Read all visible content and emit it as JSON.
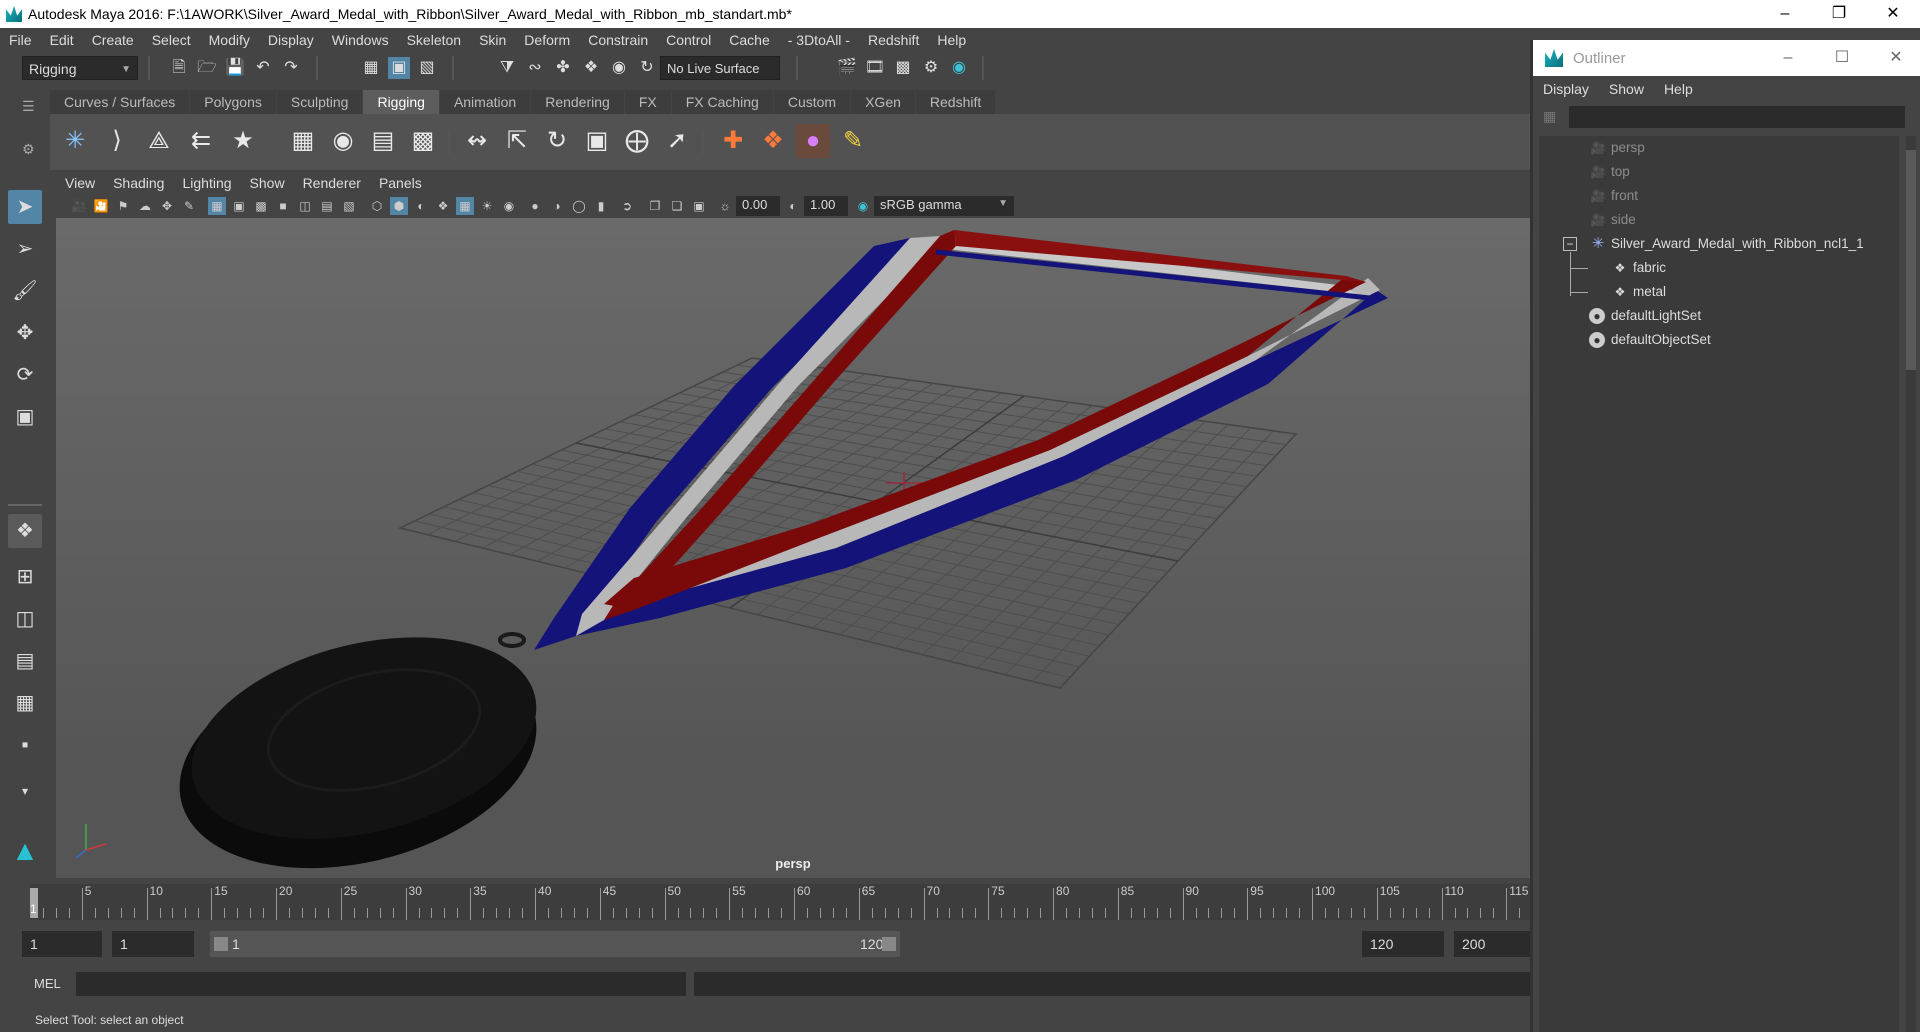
{
  "window": {
    "title": "Autodesk Maya 2016: F:\\1AWORK\\Silver_Award_Medal_with_Ribbon\\Silver_Award_Medal_with_Ribbon_mb_standart.mb*"
  },
  "menus": [
    "File",
    "Edit",
    "Create",
    "Select",
    "Modify",
    "Display",
    "Windows",
    "Skeleton",
    "Skin",
    "Deform",
    "Constrain",
    "Control",
    "Cache",
    "- 3DtoAll -",
    "Redshift",
    "Help"
  ],
  "statusline": {
    "menuset": "Rigging",
    "live_surface": "No Live Surface"
  },
  "shelf_tabs": [
    "Curves / Surfaces",
    "Polygons",
    "Sculpting",
    "Rigging",
    "Animation",
    "Rendering",
    "FX",
    "FX Caching",
    "Custom",
    "XGen",
    "Redshift"
  ],
  "active_shelf_tab": "Rigging",
  "viewport": {
    "menu": [
      "View",
      "Shading",
      "Lighting",
      "Show",
      "Renderer",
      "Panels"
    ],
    "exposure": "0.00",
    "gamma": "1.00",
    "color_space": "sRGB gamma",
    "camera": "persp"
  },
  "timeline": {
    "ticks": [
      "5",
      "10",
      "15",
      "20",
      "25",
      "30",
      "35",
      "40",
      "45",
      "50",
      "55",
      "60",
      "65",
      "70",
      "75",
      "80",
      "85",
      "90",
      "95",
      "100",
      "105",
      "110",
      "115"
    ],
    "current": "1"
  },
  "range": {
    "start": "1",
    "playback_start": "1",
    "slider_start": "1",
    "slider_end": "120",
    "playback_end": "120",
    "end": "200"
  },
  "command_line": {
    "label": "MEL"
  },
  "help_line": "Select Tool: select an object",
  "outliner": {
    "title": "Outliner",
    "menu": [
      "Display",
      "Show",
      "Help"
    ],
    "items": [
      {
        "label": "persp",
        "type": "camera",
        "dim": true
      },
      {
        "label": "top",
        "type": "camera",
        "dim": true
      },
      {
        "label": "front",
        "type": "camera",
        "dim": true
      },
      {
        "label": "side",
        "type": "camera",
        "dim": true
      },
      {
        "label": "Silver_Award_Medal_with_Ribbon_ncl1_1",
        "type": "group",
        "dim": false
      },
      {
        "label": "fabric",
        "type": "mesh",
        "dim": false
      },
      {
        "label": "metal",
        "type": "mesh",
        "dim": false
      },
      {
        "label": "defaultLightSet",
        "type": "set",
        "dim": false
      },
      {
        "label": "defaultObjectSet",
        "type": "set",
        "dim": false
      }
    ]
  },
  "colors": {
    "ribbon_blue": "#13137a",
    "ribbon_white": "#b8b8b8",
    "ribbon_red": "#7a0a0a",
    "medal": "#111111",
    "active_tool": "#5285a6"
  }
}
